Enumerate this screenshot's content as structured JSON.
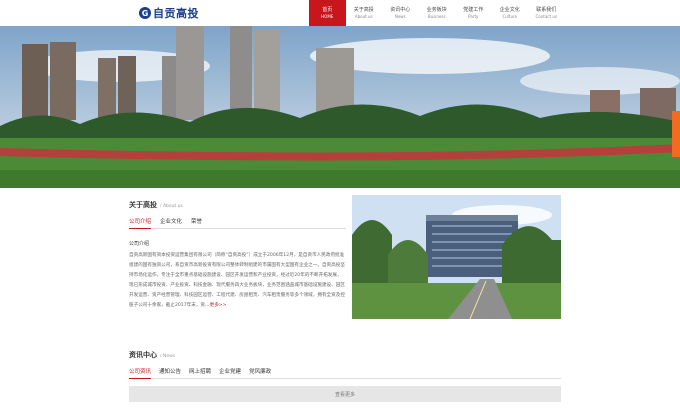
{
  "brand": {
    "mark": "G",
    "name": "自贡高投"
  },
  "nav": [
    {
      "cn": "首页",
      "en": "HOME",
      "active": true
    },
    {
      "cn": "关于高投",
      "en": "About us"
    },
    {
      "cn": "资讯中心",
      "en": "News"
    },
    {
      "cn": "业务板块",
      "en": "Business"
    },
    {
      "cn": "党建工作",
      "en": "Party"
    },
    {
      "cn": "企业文化",
      "en": "Culture"
    },
    {
      "cn": "联系我们",
      "en": "Contact us"
    }
  ],
  "about": {
    "title": "关于高投",
    "title_en": "/ About us",
    "tabs": [
      "公司介绍",
      "企业文化",
      "荣誉"
    ],
    "subtitle": "公司介绍",
    "text": "自贡高新国有资本投资运营集团有限公司（简称“自贡高投”）成立于2006年12月，是自贡市人民政府批准组建的国有独资公司，系自贡市高新投资有限公司整体转制组建的市属国有大型国有企业之一。自贡高投坚持市场化运作，专注于全市重点基础设施建设、园区开发运营和产业投资，经过近20年的不断开拓发展，现已形成城市投资、产业投资、科技金融、现代服务四大业务板块，业务范围涵盖城市基础设施建设、园区开发运营、资产经营管理、科技园区运营、工程代建、房屋租赁、汽车租赁服务等多个领域，拥有全资及控股子公司十余家，截止2017年末，资",
    "more": "…更多>>"
  },
  "news": {
    "title": "资讯中心",
    "title_en": "/ News",
    "tabs": [
      "公司资讯",
      "通知公告",
      "网上招聘",
      "企业党建",
      "党风廉政"
    ],
    "load_more": "查看更多"
  },
  "colors": {
    "brand_red": "#c8161d",
    "brand_blue": "#1d3f8a",
    "side_tab": "#f26b21"
  }
}
